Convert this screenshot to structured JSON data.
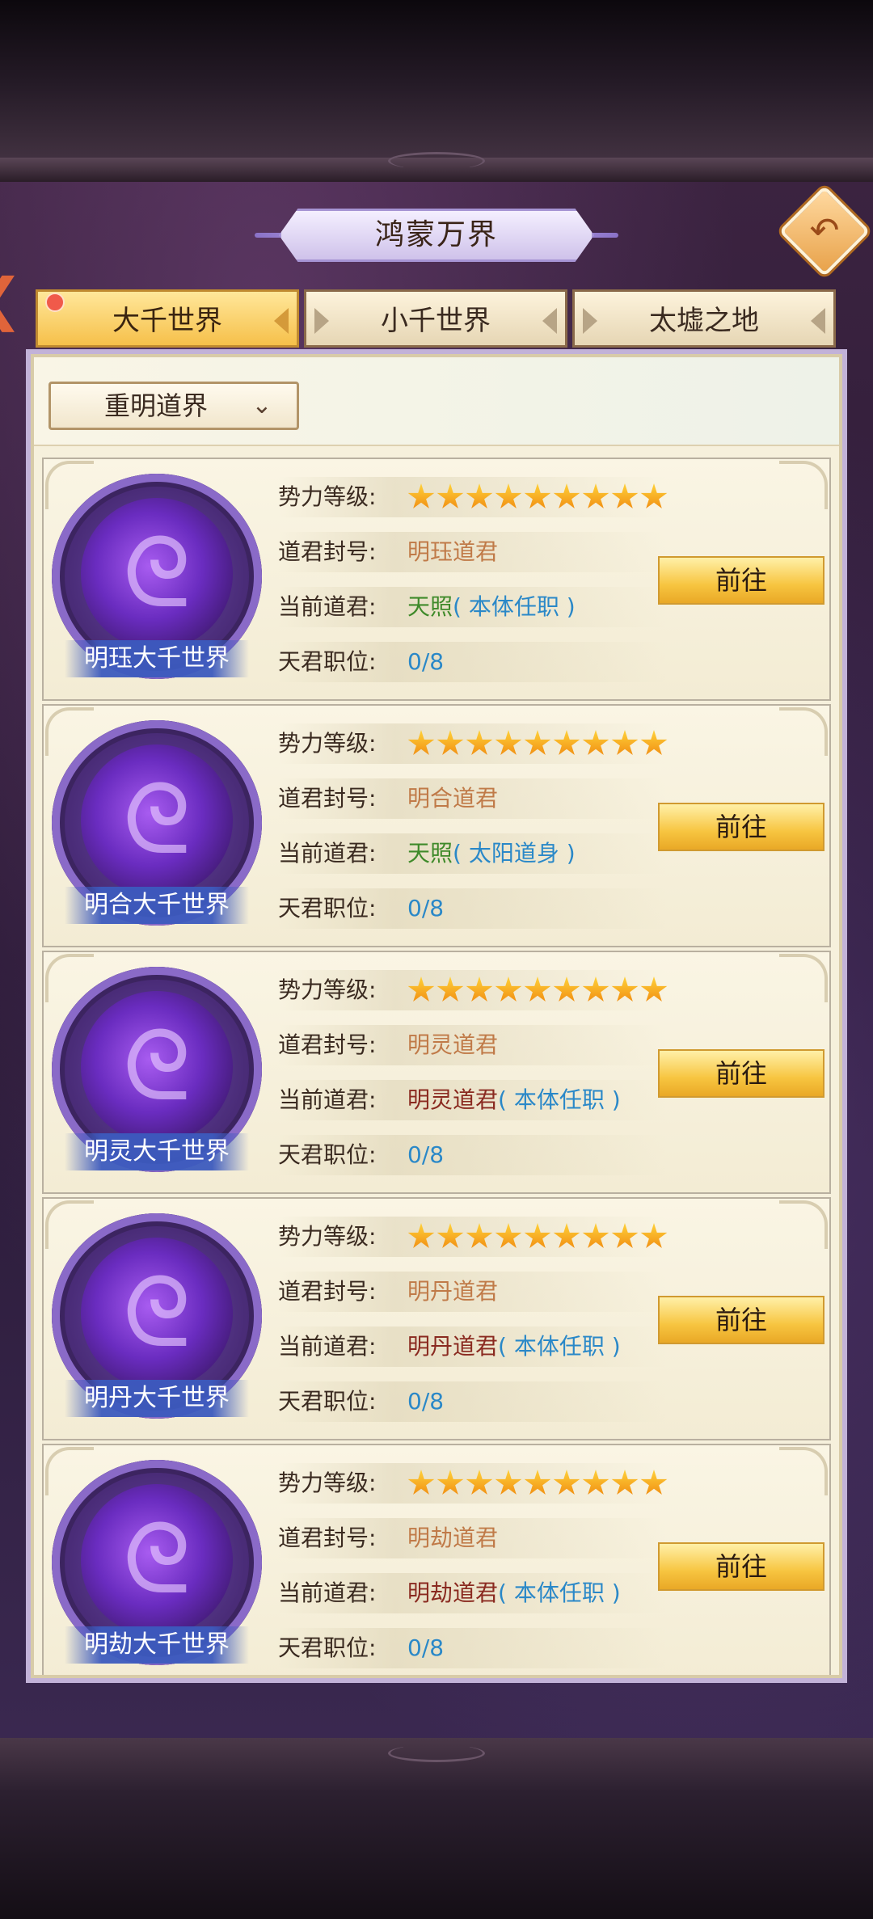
{
  "header": {
    "title": "鸿蒙万界",
    "back_icon": "back-arrow-icon"
  },
  "tabs": [
    {
      "label": "大千世界",
      "active": true,
      "has_notification": true
    },
    {
      "label": "小千世界",
      "active": false
    },
    {
      "label": "太墟之地",
      "active": false
    }
  ],
  "filter": {
    "selected": "重明道界"
  },
  "labels": {
    "power_level": "势力等级:",
    "lord_title": "道君封号:",
    "current_lord": "当前道君:",
    "positions": "天君职位:",
    "go": "前往"
  },
  "worlds": [
    {
      "name": "明珏大千世界",
      "stars": 9,
      "title": "明珏道君",
      "lord_name": "天照",
      "lord_note": "( 本体任职 )",
      "positions": "0/8",
      "lord_color": "green"
    },
    {
      "name": "明合大千世界",
      "stars": 9,
      "title": "明合道君",
      "lord_name": "天照",
      "lord_note": "( 太阳道身 )",
      "positions": "0/8",
      "lord_color": "green"
    },
    {
      "name": "明灵大千世界",
      "stars": 9,
      "title": "明灵道君",
      "lord_name": "明灵道君",
      "lord_note": "( 本体任职 )",
      "positions": "0/8",
      "lord_color": "red"
    },
    {
      "name": "明丹大千世界",
      "stars": 9,
      "title": "明丹道君",
      "lord_name": "明丹道君",
      "lord_note": "( 本体任职 )",
      "positions": "0/8",
      "lord_color": "red"
    },
    {
      "name": "明劫大千世界",
      "stars": 9,
      "title": "明劫道君",
      "lord_name": "明劫道君",
      "lord_note": "( 本体任职 )",
      "positions": "0/8",
      "lord_color": "red"
    }
  ]
}
